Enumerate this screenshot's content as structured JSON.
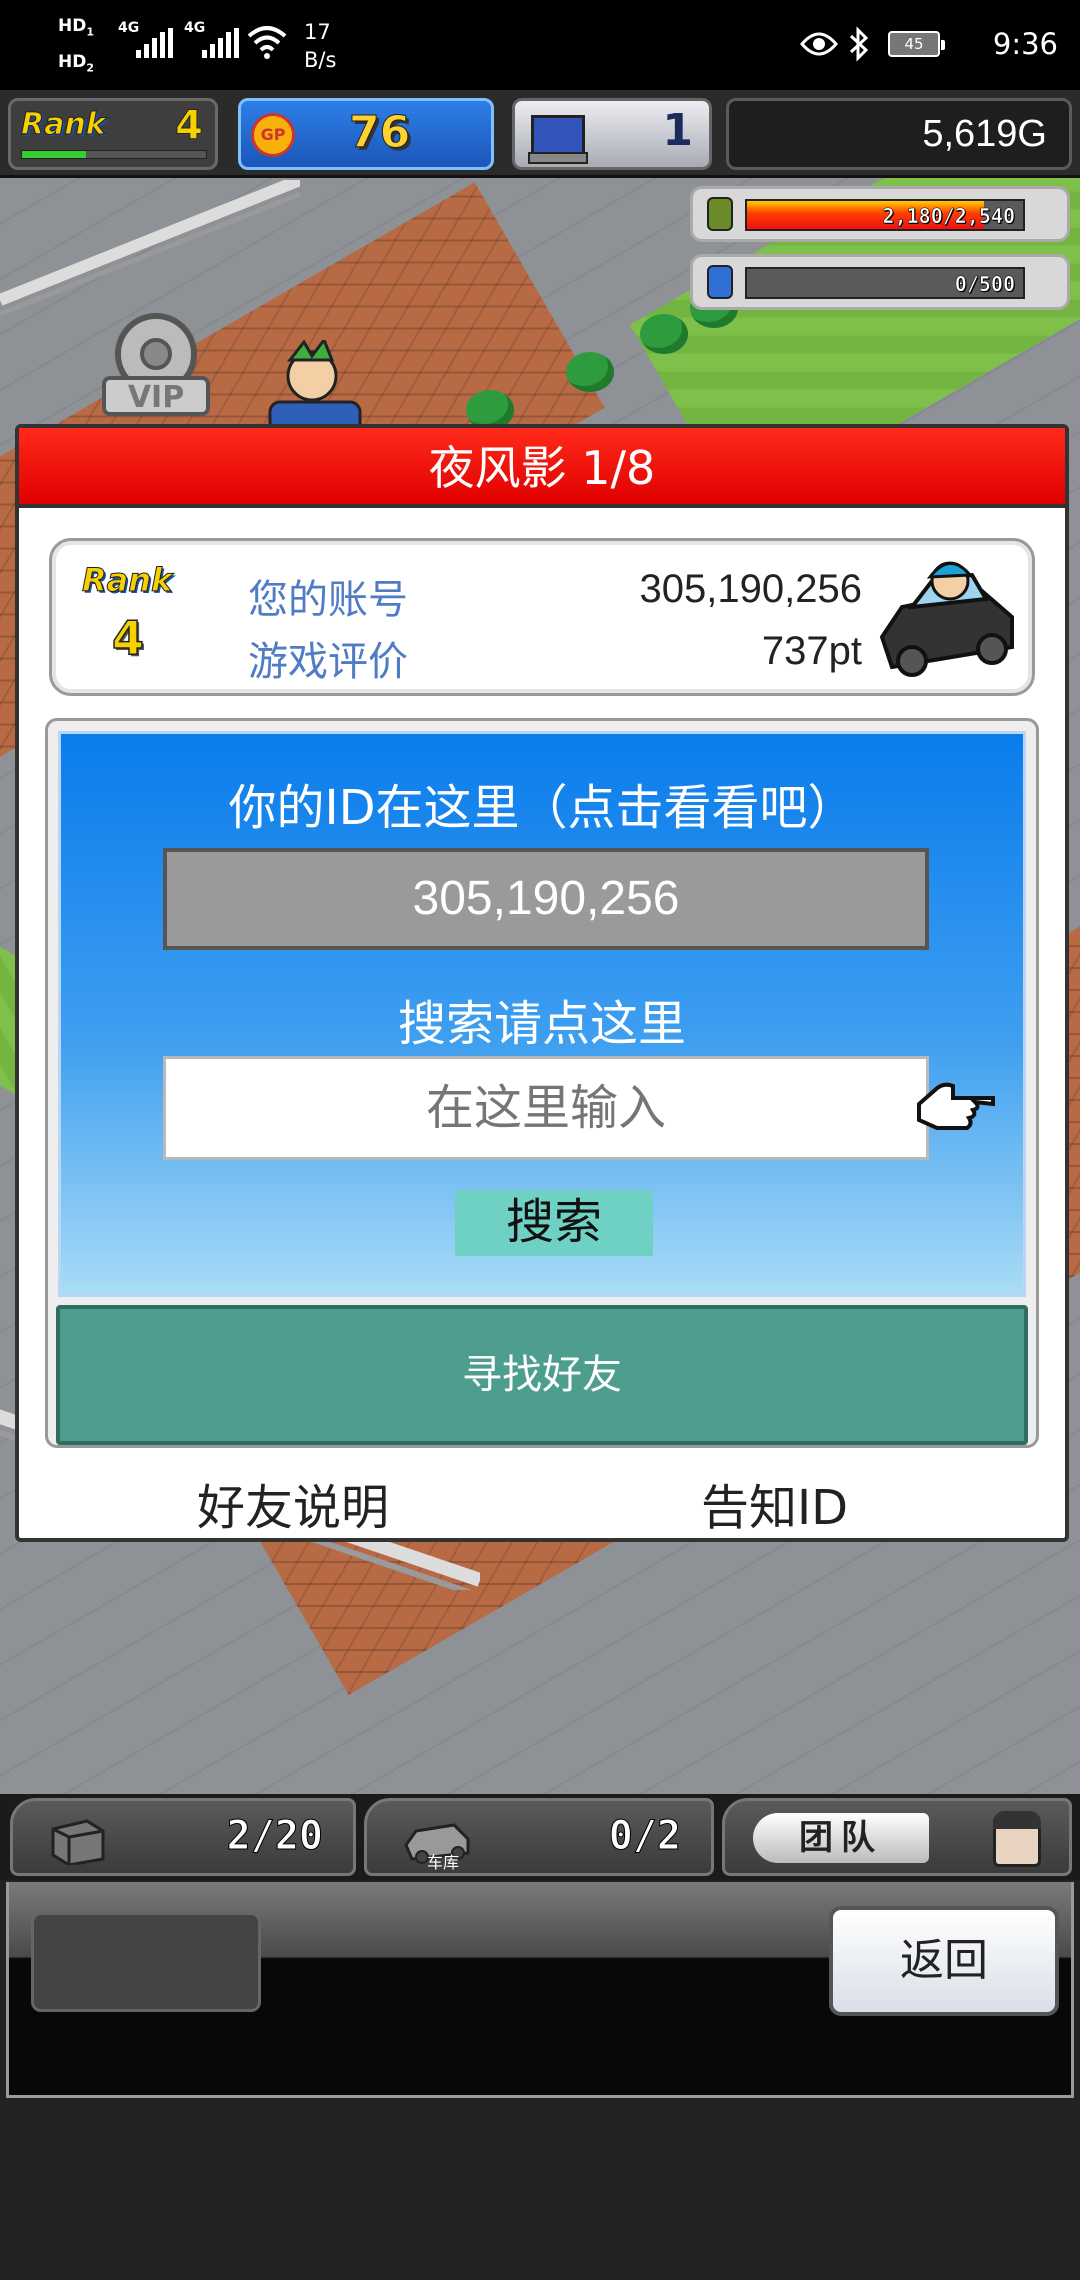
{
  "status_bar": {
    "hd1": "HD",
    "hd1_sub": "1",
    "hd2": "HD",
    "hd2_sub": "2",
    "net1": "4G",
    "net2": "4G",
    "speed_value": "17",
    "speed_unit": "B/s",
    "battery": "45",
    "time": "9:36"
  },
  "hud": {
    "rank_label": "Rank",
    "rank_value": "4",
    "rank_progress": 0.35,
    "gp_icon": "GP",
    "gp_value": "76",
    "pc_value": "1",
    "gold": "5,619G"
  },
  "resources": [
    {
      "icon": "fuel-barrel-icon",
      "text": "2,180/2,540",
      "fill": 0.86,
      "color": "#2a9d4a"
    },
    {
      "icon": "bottle-icon",
      "text": "0/500",
      "fill": 0.0,
      "color": "#2f6fd6"
    }
  ],
  "dialog": {
    "title": "夜风影 1/8",
    "info": {
      "rank_label": "Rank",
      "rank_value": "4",
      "account_label": "您的账号",
      "account_value": "305,190,256",
      "rating_label": "游戏评价",
      "rating_value": "737pt"
    },
    "id_title": "你的ID在这里（点击看看吧）",
    "id_value": "305,190,256",
    "search_hint": "搜索请点这里",
    "search_placeholder": "在这里输入",
    "search_button": "搜索",
    "find_friend": "寻找好友",
    "friend_help": "好友说明",
    "share_id": "告知ID"
  },
  "bottom_tabs": {
    "parts_count": "2/20",
    "garage_label": "车库",
    "garage_count": "0/2",
    "team_label": "团队"
  },
  "bottom_panel": {
    "back_label": "返回"
  },
  "colors": {
    "header_red": "#ff1a0a",
    "panel_blue": "#0a7cec",
    "friend_green": "#4d9e8f",
    "search_teal": "#6fd0c4",
    "label_blue": "#4f7cc4"
  }
}
